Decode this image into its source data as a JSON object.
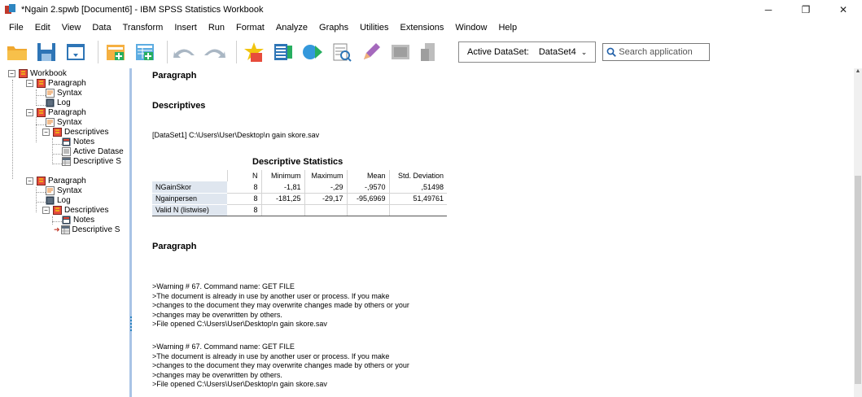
{
  "window": {
    "title": "*Ngain 2.spwb [Document6] - IBM SPSS Statistics Workbook",
    "controls": {
      "minimize": "─",
      "restore": "❐",
      "close": "✕"
    }
  },
  "menu": [
    "File",
    "Edit",
    "View",
    "Data",
    "Transform",
    "Insert",
    "Run",
    "Format",
    "Analyze",
    "Graphs",
    "Utilities",
    "Extensions",
    "Window",
    "Help"
  ],
  "toolbar": {
    "active_dataset_label": "Active DataSet:",
    "active_dataset_value": "DataSet4",
    "search_placeholder": "Search application",
    "icons": [
      "open-folder-icon",
      "save-icon",
      "print-preview-icon",
      "export-icon",
      "insert-table-icon",
      "undo-icon",
      "redo-icon",
      "goto-case-icon",
      "variables-icon",
      "run-icon",
      "syntax-icon",
      "edit-icon",
      "chart-icon",
      "page-icon"
    ]
  },
  "outline": {
    "workbook": "Workbook",
    "paragraph1": "Paragraph",
    "syntax1": "Syntax",
    "log1": "Log",
    "paragraph2": "Paragraph",
    "syntax2": "Syntax",
    "descriptives1": "Descriptives",
    "notes1": "Notes",
    "active_dataset": "Active Datase",
    "descriptive_stats1": "Descriptive S",
    "paragraph3": "Paragraph",
    "syntax3": "Syntax",
    "log2": "Log",
    "descriptives2": "Descriptives",
    "notes2": "Notes",
    "descriptive_stats2": "Descriptive S"
  },
  "content": {
    "paragraph_heading": "Paragraph",
    "descriptives_heading": "Descriptives",
    "dataset_line": "[DataSet1] C:\\Users\\User\\Desktop\\n gain skore.sav",
    "table": {
      "title": "Descriptive Statistics",
      "columns": [
        "N",
        "Minimum",
        "Maximum",
        "Mean",
        "Std. Deviation"
      ],
      "rows": [
        {
          "label": "NGainSkor",
          "n": "8",
          "min": "-1,81",
          "max": "-,29",
          "mean": "-,9570",
          "sd": ",51498"
        },
        {
          "label": "Ngainpersen",
          "n": "8",
          "min": "-181,25",
          "max": "-29,17",
          "mean": "-95,6969",
          "sd": "51,49761"
        },
        {
          "label": "Valid N (listwise)",
          "n": "8",
          "min": "",
          "max": "",
          "mean": "",
          "sd": ""
        }
      ]
    },
    "paragraph2_heading": "Paragraph",
    "warning1": [
      ">Warning # 67.  Command name: GET FILE",
      ">The document is already in use by another user or process.  If you make",
      ">changes to the document they may overwrite changes made by others or your",
      ">changes may be overwritten by others.",
      ">File opened C:\\Users\\User\\Desktop\\n gain skore.sav"
    ],
    "warning2": [
      ">Warning # 67.  Command name: GET FILE",
      ">The document is already in use by another user or process.  If you make",
      ">changes to the document they may overwrite changes made by others or your",
      ">changes may be overwritten by others.",
      ">File opened C:\\Users\\User\\Desktop\\n gain skore.sav"
    ]
  }
}
